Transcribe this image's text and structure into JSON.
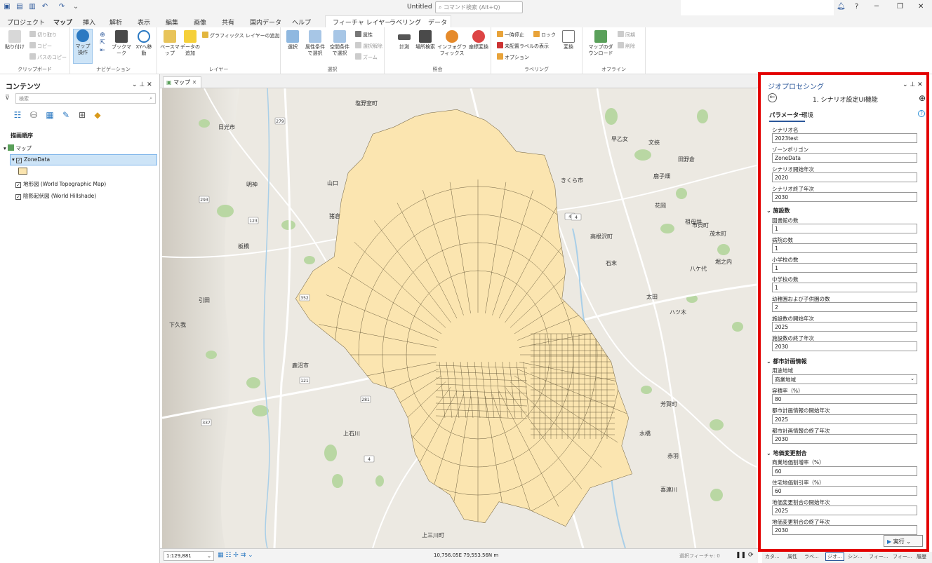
{
  "window": {
    "title": "Untitled",
    "command_search_placeholder": "コマンド検索 (Alt+Q)"
  },
  "colors": {
    "accent": "#2b579a",
    "highlight": "#e30000",
    "zone_fill": "#fbe5b0",
    "zone_stroke": "#6e6040"
  },
  "tabs": [
    "プロジェクト",
    "マップ",
    "挿入",
    "解析",
    "表示",
    "編集",
    "画像",
    "共有",
    "国内データ",
    "ヘルプ",
    "フィーチャ レイヤー",
    "ラベリング",
    "データ"
  ],
  "active_tab": "マップ",
  "ribbon": {
    "clipboard": {
      "label": "クリップボード",
      "paste": "貼り付け",
      "cut": "切り取り",
      "copy": "コピー",
      "copy_path": "パスのコピー"
    },
    "navigation": {
      "label": "ナビゲーション",
      "explore": "マップ操作",
      "bookmarks": "ブックマーク",
      "goto_xy": "XYへ移動"
    },
    "layer": {
      "label": "レイヤー",
      "basemap": "ベースマップ",
      "add_data": "データの追加",
      "add_graphics": "グラフィックス レイヤーの追加"
    },
    "selection": {
      "label": "選択",
      "select": "選択",
      "select_by_attr": "属性条件で選択",
      "select_by_loc": "空間条件で選択",
      "attributes": "属性",
      "clear": "選択解除",
      "zoom": "ズーム"
    },
    "inquiry": {
      "label": "照会",
      "measure": "計測",
      "locate": "場所検索",
      "infographics": "インフォグラフィックス",
      "coords": "座標変換"
    },
    "labeling": {
      "label": "ラベリング",
      "pause": "一時停止",
      "lock": "ロック",
      "unplaced": "未配置ラベルの表示",
      "options": "オプション",
      "convert": "変換"
    },
    "offline": {
      "label": "オフライン",
      "download": "マップのダウンロード",
      "sync": "同期",
      "remove": "削除"
    }
  },
  "contents": {
    "title": "コンテンツ",
    "search_placeholder": "検索",
    "draw_order": "描画順序",
    "layers": {
      "map": "マップ",
      "zone": "ZoneData",
      "topo": "地形図 (World Topographic Map)",
      "hillshade": "陰影起伏図 (World Hillshade)"
    }
  },
  "map": {
    "tab": "マップ",
    "scale": "1:129,881",
    "coords": "10,756.05E 79,553.56N m",
    "selected": "選択フィーチャ: 0",
    "places": [
      "塩野室町",
      "日光市",
      "明神",
      "山口",
      "猪倉",
      "板橋",
      "引田",
      "下久我",
      "鹿沼市",
      "上石川",
      "上三川町",
      "きくら市",
      "高根沢町",
      "石末",
      "太田",
      "ハツ木",
      "芳賀町",
      "水橋",
      "赤羽",
      "喜連川",
      "早乙女",
      "文挾",
      "鹿子畑",
      "田野倉",
      "祖母井",
      "市貝町",
      "茂木町",
      "花岡",
      "八ケ代",
      "堀之内"
    ],
    "roads": [
      "279",
      "4",
      "293",
      "281",
      "352",
      "121",
      "337",
      "4",
      "123",
      "4"
    ]
  },
  "gp": {
    "title": "ジオプロセシング",
    "tool": "1. シナリオ設定UI機能",
    "tab_params": "パラメーター",
    "tab_env": "環境",
    "run": "実行",
    "params": [
      {
        "label": "シナリオ名",
        "value": "2023test"
      },
      {
        "label": "ゾーンポリゴン",
        "value": "ZoneData"
      },
      {
        "label": "シナリオ開始年次",
        "value": "2020"
      },
      {
        "label": "シナリオ終了年次",
        "value": "2030"
      }
    ],
    "facilities": {
      "title": "施設数",
      "params": [
        {
          "label": "図書館の数",
          "value": "1"
        },
        {
          "label": "病院の数",
          "value": "1"
        },
        {
          "label": "小学校の数",
          "value": "1"
        },
        {
          "label": "中学校の数",
          "value": "1"
        },
        {
          "label": "幼稚園および子供園の数",
          "value": "2"
        },
        {
          "label": "施設数の開始年次",
          "value": "2025"
        },
        {
          "label": "施設数の終了年次",
          "value": "2030"
        }
      ]
    },
    "urban": {
      "title": "都市計画情報",
      "params": [
        {
          "label": "用途地域",
          "value": "商業地域"
        },
        {
          "label": "容積率（%）",
          "value": "80"
        },
        {
          "label": "都市計画情報の開始年次",
          "value": "2025"
        },
        {
          "label": "都市計画情報の終了年次",
          "value": "2030"
        }
      ]
    },
    "land": {
      "title": "地価変更割合",
      "params": [
        {
          "label": "商業地価割増率（%）",
          "value": "60"
        },
        {
          "label": "住宅地価割引率（%）",
          "value": "60"
        },
        {
          "label": "地価変更割合の開始年次",
          "value": "2025"
        },
        {
          "label": "地価変更割合の終了年次",
          "value": "2030"
        }
      ]
    }
  },
  "bottom_tabs": [
    "カタ...",
    "属性",
    "ラベ...",
    "ジオ...",
    "シン...",
    "フィー...",
    "フィー...",
    "履歴"
  ]
}
